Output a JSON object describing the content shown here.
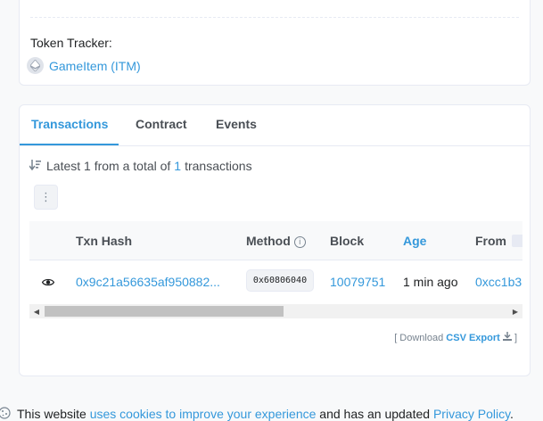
{
  "token_tracker": {
    "label": "Token Tracker:",
    "link": "GameItem (ITM)"
  },
  "tabs": [
    {
      "label": "Transactions",
      "active": true
    },
    {
      "label": "Contract",
      "active": false
    },
    {
      "label": "Events",
      "active": false
    }
  ],
  "summary": {
    "prefix": "Latest 1 from a total of",
    "count": "1",
    "suffix": "transactions"
  },
  "table": {
    "headers": {
      "txn_hash": "Txn Hash",
      "method": "Method",
      "block": "Block",
      "age": "Age",
      "from": "From"
    },
    "rows": [
      {
        "txn_hash": "0x9c21a56635af950882...",
        "method": "0x60806040",
        "block": "10079751",
        "age": "1 min ago",
        "from": "0xcc1b3"
      }
    ]
  },
  "download": {
    "open_bracket": "[ Download",
    "csv": "CSV Export",
    "close_bracket": "]"
  },
  "cookie_bar": {
    "text1": "This website",
    "link1": "uses cookies to improve your experience",
    "text2": "and has an updated",
    "link2": "Privacy Policy",
    "text3": "."
  },
  "colors": {
    "accent": "#3498db",
    "text": "#1e2022",
    "muted": "#77838f",
    "border": "#e7eaf3"
  }
}
